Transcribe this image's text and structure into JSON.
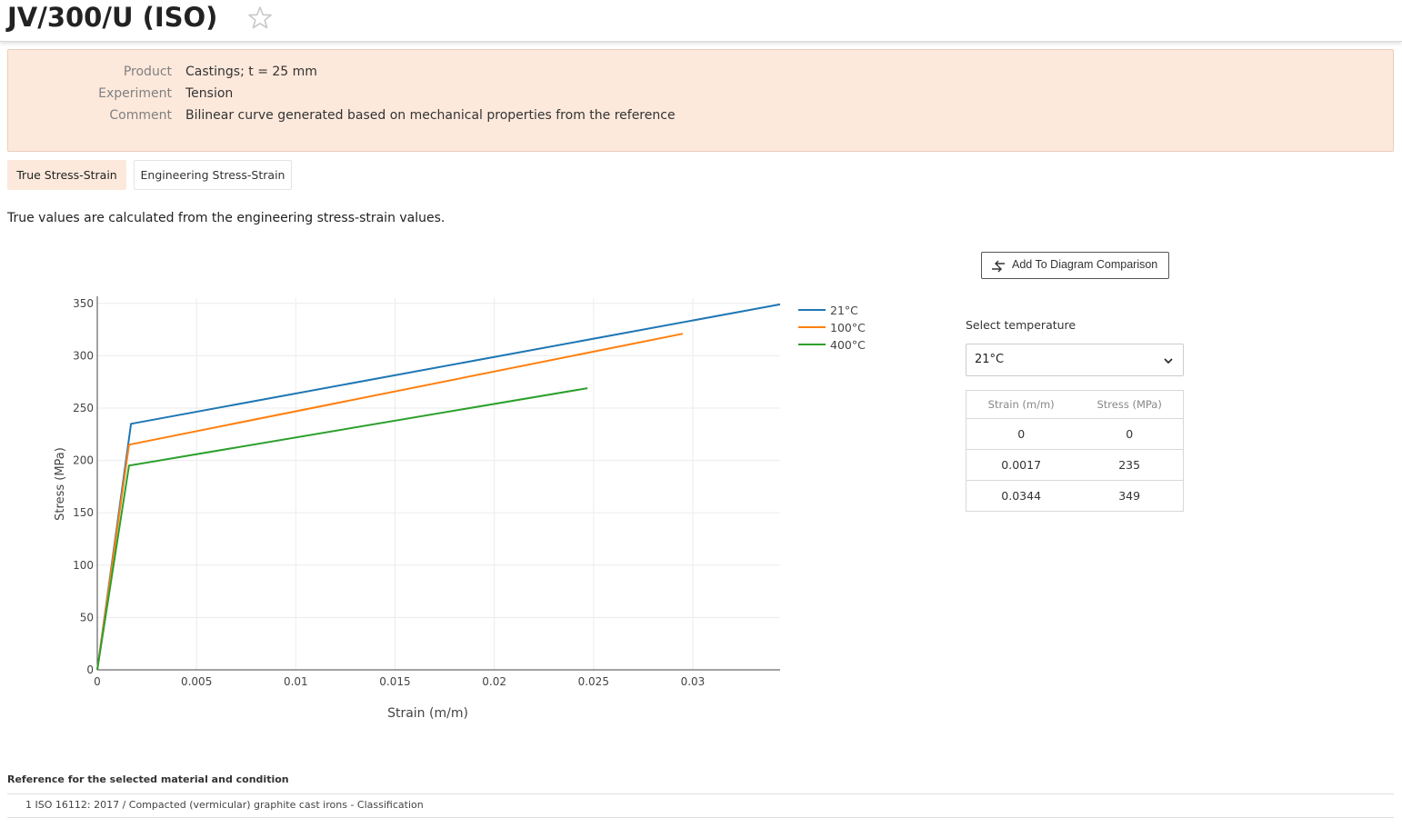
{
  "header": {
    "title": "JV/300/U (ISO)"
  },
  "info": {
    "rows": [
      {
        "label": "Product",
        "value": "Castings; t = 25 mm"
      },
      {
        "label": "Experiment",
        "value": "Tension"
      },
      {
        "label": "Comment",
        "value": "Bilinear curve generated based on mechanical properties from the reference"
      }
    ]
  },
  "tabs": [
    {
      "label": "True Stress-Strain",
      "active": true
    },
    {
      "label": "Engineering Stress-Strain",
      "active": false
    }
  ],
  "note": "True values are calculated from the engineering stress-strain values.",
  "compare_button": {
    "label": "Add To Diagram Comparison",
    "icon": "compare-arrows-icon"
  },
  "temperature_select": {
    "label": "Select temperature",
    "selected": "21°C",
    "icon": "chevron-down-icon"
  },
  "table": {
    "headers": [
      "Strain (m/m)",
      "Stress (MPa)"
    ],
    "rows": [
      [
        "0",
        "0"
      ],
      [
        "0.0017",
        "235"
      ],
      [
        "0.0344",
        "349"
      ]
    ]
  },
  "chart_data": {
    "type": "line",
    "xlabel": "Strain (m/m)",
    "ylabel": "Stress (MPa)",
    "xlim": [
      0,
      0.0344
    ],
    "ylim": [
      0,
      355
    ],
    "xticks": [
      0,
      0.005,
      0.01,
      0.015,
      0.02,
      0.025,
      0.03
    ],
    "xtick_labels": [
      "0",
      "0.005",
      "0.01",
      "0.015",
      "0.02",
      "0.025",
      "0.03"
    ],
    "yticks": [
      0,
      50,
      100,
      150,
      200,
      250,
      300,
      350
    ],
    "ytick_labels": [
      "0",
      "50",
      "100",
      "150",
      "200",
      "250",
      "300",
      "350"
    ],
    "grid": true,
    "legend_position": "top-right",
    "series": [
      {
        "name": "21°C",
        "color": "#1f77b4",
        "x": [
          0,
          0.0017,
          0.0344
        ],
        "y": [
          0,
          235,
          349
        ]
      },
      {
        "name": "100°C",
        "color": "#ff7f0e",
        "x": [
          0,
          0.0016,
          0.0295
        ],
        "y": [
          0,
          215,
          321
        ]
      },
      {
        "name": "400°C",
        "color": "#2ca02c",
        "x": [
          0,
          0.0016,
          0.0247
        ],
        "y": [
          0,
          195,
          269
        ]
      }
    ]
  },
  "reference": {
    "heading": "Reference for the selected material and condition",
    "items": [
      {
        "number": "1",
        "text": "ISO 16112: 2017 / Compacted (vermicular) graphite cast irons - Classification"
      }
    ]
  },
  "colors": {
    "accent_bg": "#fde9dc",
    "star_outline": "#c8c8c8"
  }
}
